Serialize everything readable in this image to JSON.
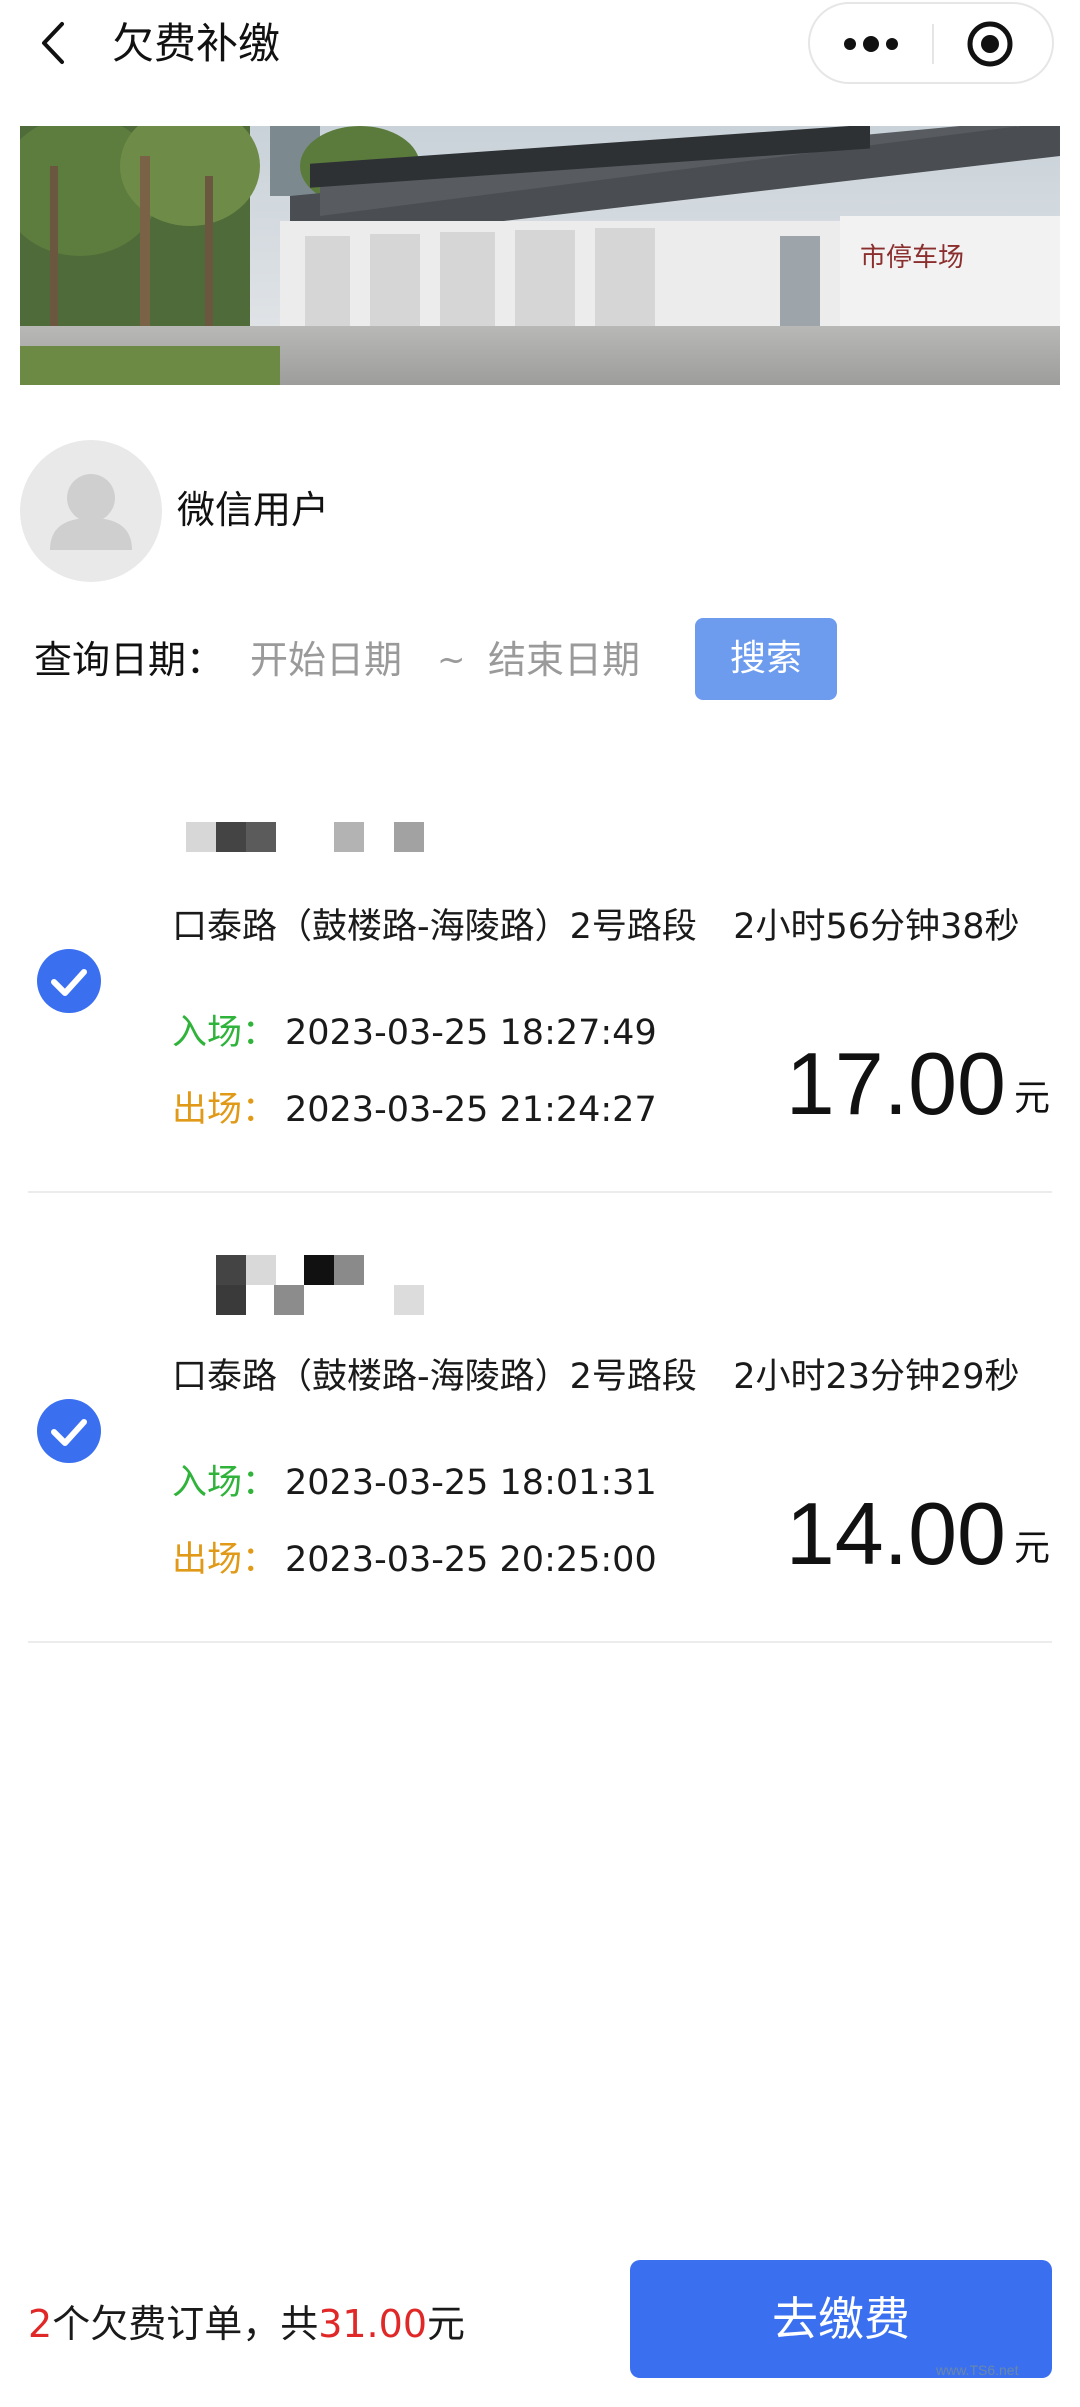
{
  "nav": {
    "title": "欠费补缴"
  },
  "banner": {
    "sign_text": "市停车场"
  },
  "user": {
    "name": "微信用户"
  },
  "search": {
    "label": "查询日期：",
    "start_placeholder": "开始日期",
    "separator": "~",
    "end_placeholder": "结束日期",
    "button_label": "搜索"
  },
  "orders": [
    {
      "road": "口泰路（鼓楼路-海陵路）2号路段",
      "duration": "2小时56分钟38秒",
      "entry_label": "入场：",
      "entry_time": "2023-03-25 18:27:49",
      "exit_label": "出场：",
      "exit_time": "2023-03-25 21:24:27",
      "amount": "17.00",
      "unit": "元",
      "checked": true
    },
    {
      "road": "口泰路（鼓楼路-海陵路）2号路段",
      "duration": "2小时23分钟29秒",
      "entry_label": "入场：",
      "entry_time": "2023-03-25 18:01:31",
      "exit_label": "出场：",
      "exit_time": "2023-03-25 20:25:00",
      "amount": "14.00",
      "unit": "元",
      "checked": true
    }
  ],
  "footer": {
    "count": "2",
    "count_text": "个欠费订单，共",
    "total": "31.00",
    "unit": "元",
    "pay_label": "去缴费"
  },
  "watermark": {
    "text": "www.TS6.net"
  },
  "colors": {
    "accent": "#3a6ff0",
    "search_button": "#6d9cef",
    "entry": "#2fb33a",
    "exit": "#e09a18",
    "total": "#e02828",
    "check": "#3a6ff0"
  }
}
